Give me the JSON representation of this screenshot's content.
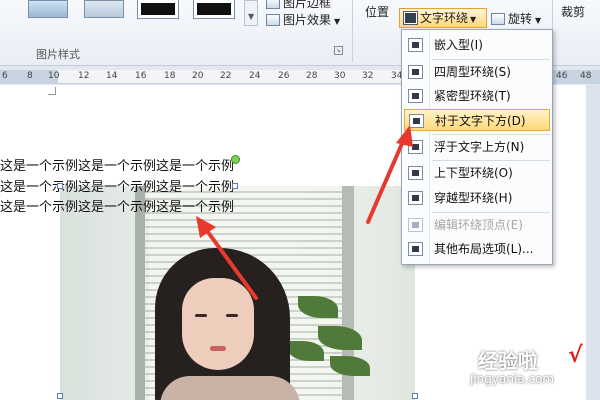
{
  "ribbon": {
    "top_item_1": "图片边框",
    "picture_effects": "图片效果",
    "group_label": "图片样式",
    "position": "位置",
    "text_wrap": "文字环绕",
    "rotate": "旋转",
    "crop": "裁剪",
    "icons": {
      "picture_effects": "picture-effects-icon",
      "text_wrap": "text-wrap-icon",
      "rotate": "rotate-icon"
    }
  },
  "ruler": {
    "labels": [
      "6",
      "8",
      "10",
      "12",
      "14",
      "16",
      "18",
      "20",
      "22",
      "24",
      "26",
      "28",
      "30",
      "32",
      "34",
      "36",
      "38",
      "40",
      "42",
      "44",
      "46",
      "48"
    ]
  },
  "document": {
    "lines": [
      "这是一个示例这是一个示例这是一个示例",
      "这是一个示例这是一个示例这是一个示例",
      "这是一个示例这是一个示例这是一个示例"
    ]
  },
  "wrap_menu": {
    "items": [
      {
        "label": "嵌入型(I)",
        "enabled": true,
        "highlighted": false
      },
      {
        "label": "四周型环绕(S)",
        "enabled": true,
        "highlighted": false
      },
      {
        "label": "紧密型环绕(T)",
        "enabled": true,
        "highlighted": false
      },
      {
        "label": "衬于文字下方(D)",
        "enabled": true,
        "highlighted": true
      },
      {
        "label": "浮于文字上方(N)",
        "enabled": true,
        "highlighted": false
      },
      {
        "label": "上下型环绕(O)",
        "enabled": true,
        "highlighted": false
      },
      {
        "label": "穿越型环绕(H)",
        "enabled": true,
        "highlighted": false
      },
      {
        "label": "编辑环绕顶点(E)",
        "enabled": false,
        "highlighted": false
      },
      {
        "label": "其他布局选项(L)...",
        "enabled": true,
        "highlighted": false
      }
    ]
  },
  "watermark": {
    "main": "经验啦",
    "check": "√",
    "url": "jingyanla.com"
  },
  "colors": {
    "highlight": "#ffd978",
    "arrow": "#e8392e",
    "rotate_handle": "#7ed257"
  }
}
